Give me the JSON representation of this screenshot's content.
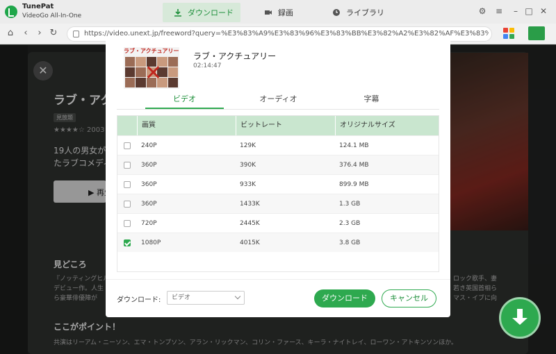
{
  "app": {
    "name": "TunePat",
    "subtitle": "VideoGo All-In-One"
  },
  "tabs": [
    {
      "label": "ダウンロード",
      "active": true,
      "icon": "download-icon"
    },
    {
      "label": "録画",
      "active": false,
      "icon": "camera-icon"
    },
    {
      "label": "ライブラリ",
      "active": false,
      "icon": "clock-icon"
    }
  ],
  "window_controls": [
    "gear-icon",
    "menu-icon",
    "minimize-icon",
    "maximize-icon",
    "close-icon"
  ],
  "browser": {
    "url": "https://video.unext.jp/freeword?query=%E3%83%A9%E3%83%96%E3%83%BB%E3%82%A2%E3%82%AF%E3%83%81%E3%83%A5%E3%82%A2"
  },
  "background": {
    "title": "ラブ・アクチュアリー",
    "badge": "見放題",
    "rating": "★★★★☆ 2003",
    "desc_lines": [
      "19人の男女が繰り広げる",
      "たラブコメディ"
    ],
    "play_label": "▶ 再生",
    "h_midokoro": "見どころ",
    "midokoro_lines": [
      "『ノッティングヒルの恋人』",
      "デビュー作。人生",
      "ら豪華俳優陣が"
    ],
    "midokoro_right": [
      "ロック歌手、妻",
      "若き英国首相ら",
      "マス・イブに向"
    ],
    "h_point": "ここがポイント！",
    "point_text": "共演はリーアム・ニーソン、エマ・トンプソン、アラン・リックマン、コリン・ファース、キーラ・ナイトレイ、ローワン・アトキンソンほか。"
  },
  "dialog": {
    "thumb_title": "ラブ・アクチュアリー",
    "title": "ラブ・アクチュアリー",
    "duration": "02:14:47",
    "tabs": [
      {
        "label": "ビデオ",
        "active": true
      },
      {
        "label": "オーディオ",
        "active": false
      },
      {
        "label": "字幕",
        "active": false
      }
    ],
    "columns": [
      "画質",
      "ビットレート",
      "オリジナルサイズ"
    ],
    "rows": [
      {
        "quality": "240P",
        "bitrate": "129K",
        "size": "124.1 MB",
        "checked": false
      },
      {
        "quality": "360P",
        "bitrate": "390K",
        "size": "376.4 MB",
        "checked": false
      },
      {
        "quality": "360P",
        "bitrate": "933K",
        "size": "899.9 MB",
        "checked": false
      },
      {
        "quality": "360P",
        "bitrate": "1433K",
        "size": "1.3 GB",
        "checked": false
      },
      {
        "quality": "720P",
        "bitrate": "2445K",
        "size": "2.3 GB",
        "checked": false
      },
      {
        "quality": "1080P",
        "bitrate": "4015K",
        "size": "3.8 GB",
        "checked": true
      }
    ],
    "download_label": "ダウンロード:",
    "download_select": "ビデオ",
    "download_button": "ダウンロード",
    "cancel_button": "キャンセル"
  },
  "colors": {
    "accent": "#2ea94f",
    "header_row": "#c9e6cf"
  }
}
